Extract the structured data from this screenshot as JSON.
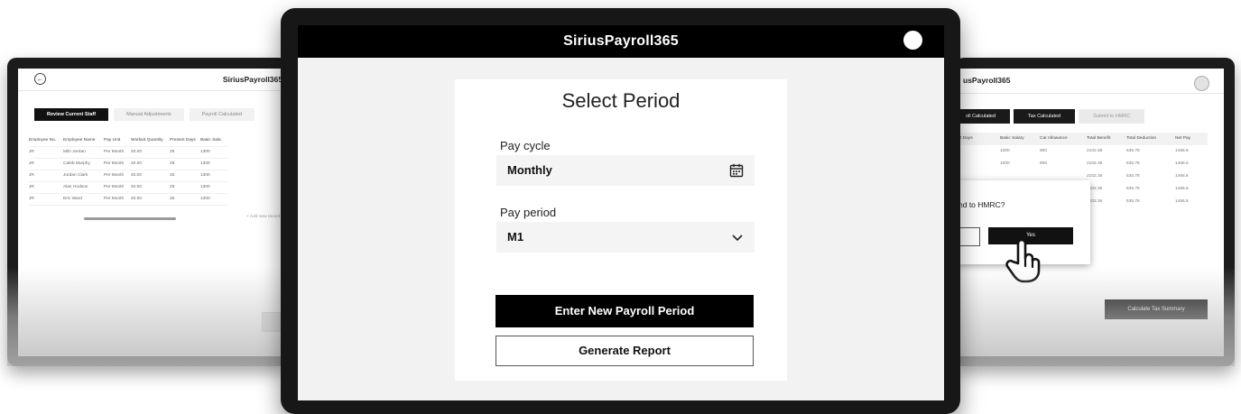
{
  "left_screen": {
    "app_title": "SiriusPayroll365",
    "back_glyph": "←",
    "steps": [
      "Review Current Staff",
      "Manual Adjustments",
      "Payroll Calculated"
    ],
    "columns": [
      "Employee No.",
      "Employee Name",
      "Pay Unit",
      "Worked Quantity",
      "Present Days",
      "Basic Sala"
    ],
    "rows": [
      [
        "JR",
        "Milo Jordan",
        "Per Month",
        "40.00",
        "25",
        "1300"
      ],
      [
        "JR",
        "Caleb Murphy",
        "Per Month",
        "40.00",
        "25",
        "1300"
      ],
      [
        "JR",
        "Jordan Clark",
        "Per Month",
        "40.00",
        "25",
        "1300"
      ],
      [
        "JR",
        "Alan Hodson",
        "Per Month",
        "40.00",
        "25",
        "1300"
      ],
      [
        "JR",
        "Eric Ward",
        "Per Month",
        "40.00",
        "25",
        "1300"
      ]
    ],
    "add_record": "+ Add new record",
    "button_label": "C"
  },
  "center_screen": {
    "app_title": "SiriusPayroll365",
    "heading": "Select Period",
    "pay_cycle": {
      "label": "Pay cycle",
      "value": "Monthly"
    },
    "pay_period": {
      "label": "Pay period",
      "value": "M1"
    },
    "primary_button": "Enter New Payroll Period",
    "secondary_button": "Generate Report"
  },
  "right_screen": {
    "app_title": "usPayroll365",
    "steps": [
      "oll Calculated",
      "Tax Calculated",
      "Submit to HMRC"
    ],
    "columns": [
      "t Days",
      "Basic Salary",
      "Car Allowance",
      "Total Benefit",
      "Total Deduction",
      "Net Pay"
    ],
    "rows": [
      [
        "",
        "1000",
        "900",
        "2102.36",
        "635.78",
        "1466.6"
      ],
      [
        "",
        "1000",
        "900",
        "2102.36",
        "635.78",
        "1466.6"
      ],
      [
        "",
        "",
        "",
        "2102.36",
        "635.78",
        "1466.6"
      ],
      [
        "",
        "",
        "",
        "2102.36",
        "635.78",
        "1466.6"
      ],
      [
        "",
        "",
        "",
        "2102.36",
        "635.78",
        "1466.6"
      ]
    ],
    "dialog_text": "nd to HMRC?",
    "dialog_yes": "Yes",
    "calc_button": "Calculate Tax Summary"
  }
}
